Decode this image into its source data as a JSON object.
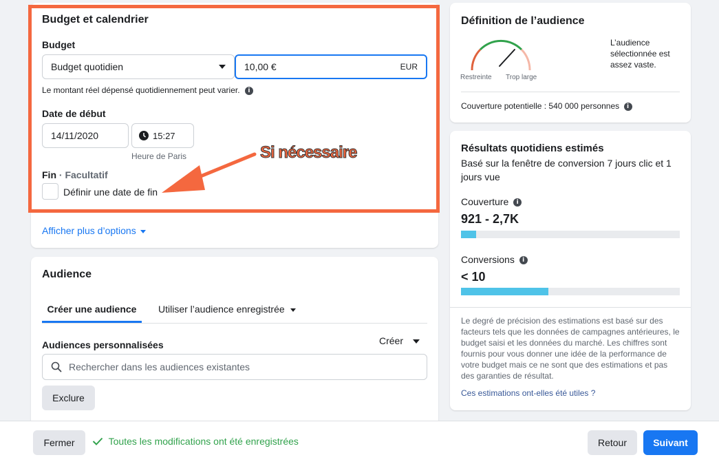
{
  "budget_section": {
    "title": "Budget et calendrier",
    "budget_label": "Budget",
    "budget_type": "Budget quotidien",
    "amount": "10,00 €",
    "currency": "EUR",
    "note": "Le montant réel dépensé quotidiennement peut varier.",
    "start_label": "Date de début",
    "start_date": "14/11/2020",
    "start_time": "15:27",
    "timezone": "Heure de Paris",
    "end_label": "Fin",
    "end_optional": "· Facultatif",
    "end_checkbox_label": "Définir une date de fin",
    "annotation": "Si nécessaire",
    "more_options": "Afficher plus d’options"
  },
  "audience_section": {
    "title": "Audience",
    "tabs": [
      "Créer une audience",
      "Utiliser l’audience enregistrée"
    ],
    "custom_label": "Audiences personnalisées",
    "create_label": "Créer",
    "search_placeholder": "Rechercher dans les audiences existantes",
    "exclude_label": "Exclure"
  },
  "definition": {
    "title": "Définition de l’audience",
    "gauge_left": "Restreinte",
    "gauge_right": "Trop large",
    "gauge_level": 0.72,
    "description": "L’audience sélectionnée est assez vaste.",
    "coverage": "Couverture potentielle : 540 000 personnes"
  },
  "results": {
    "title": "Résultats quotidiens estimés",
    "subtitle": "Basé sur la fenêtre de conversion 7 jours clic et 1 jours vue",
    "reach_label": "Couverture",
    "reach_value": "921 - 2,7K",
    "reach_fill": 0.07,
    "conv_label": "Conversions",
    "conv_value": "< 10",
    "conv_fill": 0.4,
    "disclaimer": "Le degré de précision des estimations est basé sur des facteurs tels que les données de campagnes antérieures, le budget saisi et les données du marché. Les chiffres sont fournis pour vous donner une idée de la performance de votre budget mais ce ne sont que des estimations et pas des garanties de résultat.",
    "feedback_link": "Ces estimations ont-elles été utiles ?"
  },
  "footer": {
    "close": "Fermer",
    "saved": "Toutes les modifications ont été enregistrées",
    "back": "Retour",
    "next": "Suivant"
  },
  "colors": {
    "accent": "#1877f2",
    "annotation": "#f4683f",
    "bar": "#4fc3e8",
    "success": "#31a24c"
  }
}
